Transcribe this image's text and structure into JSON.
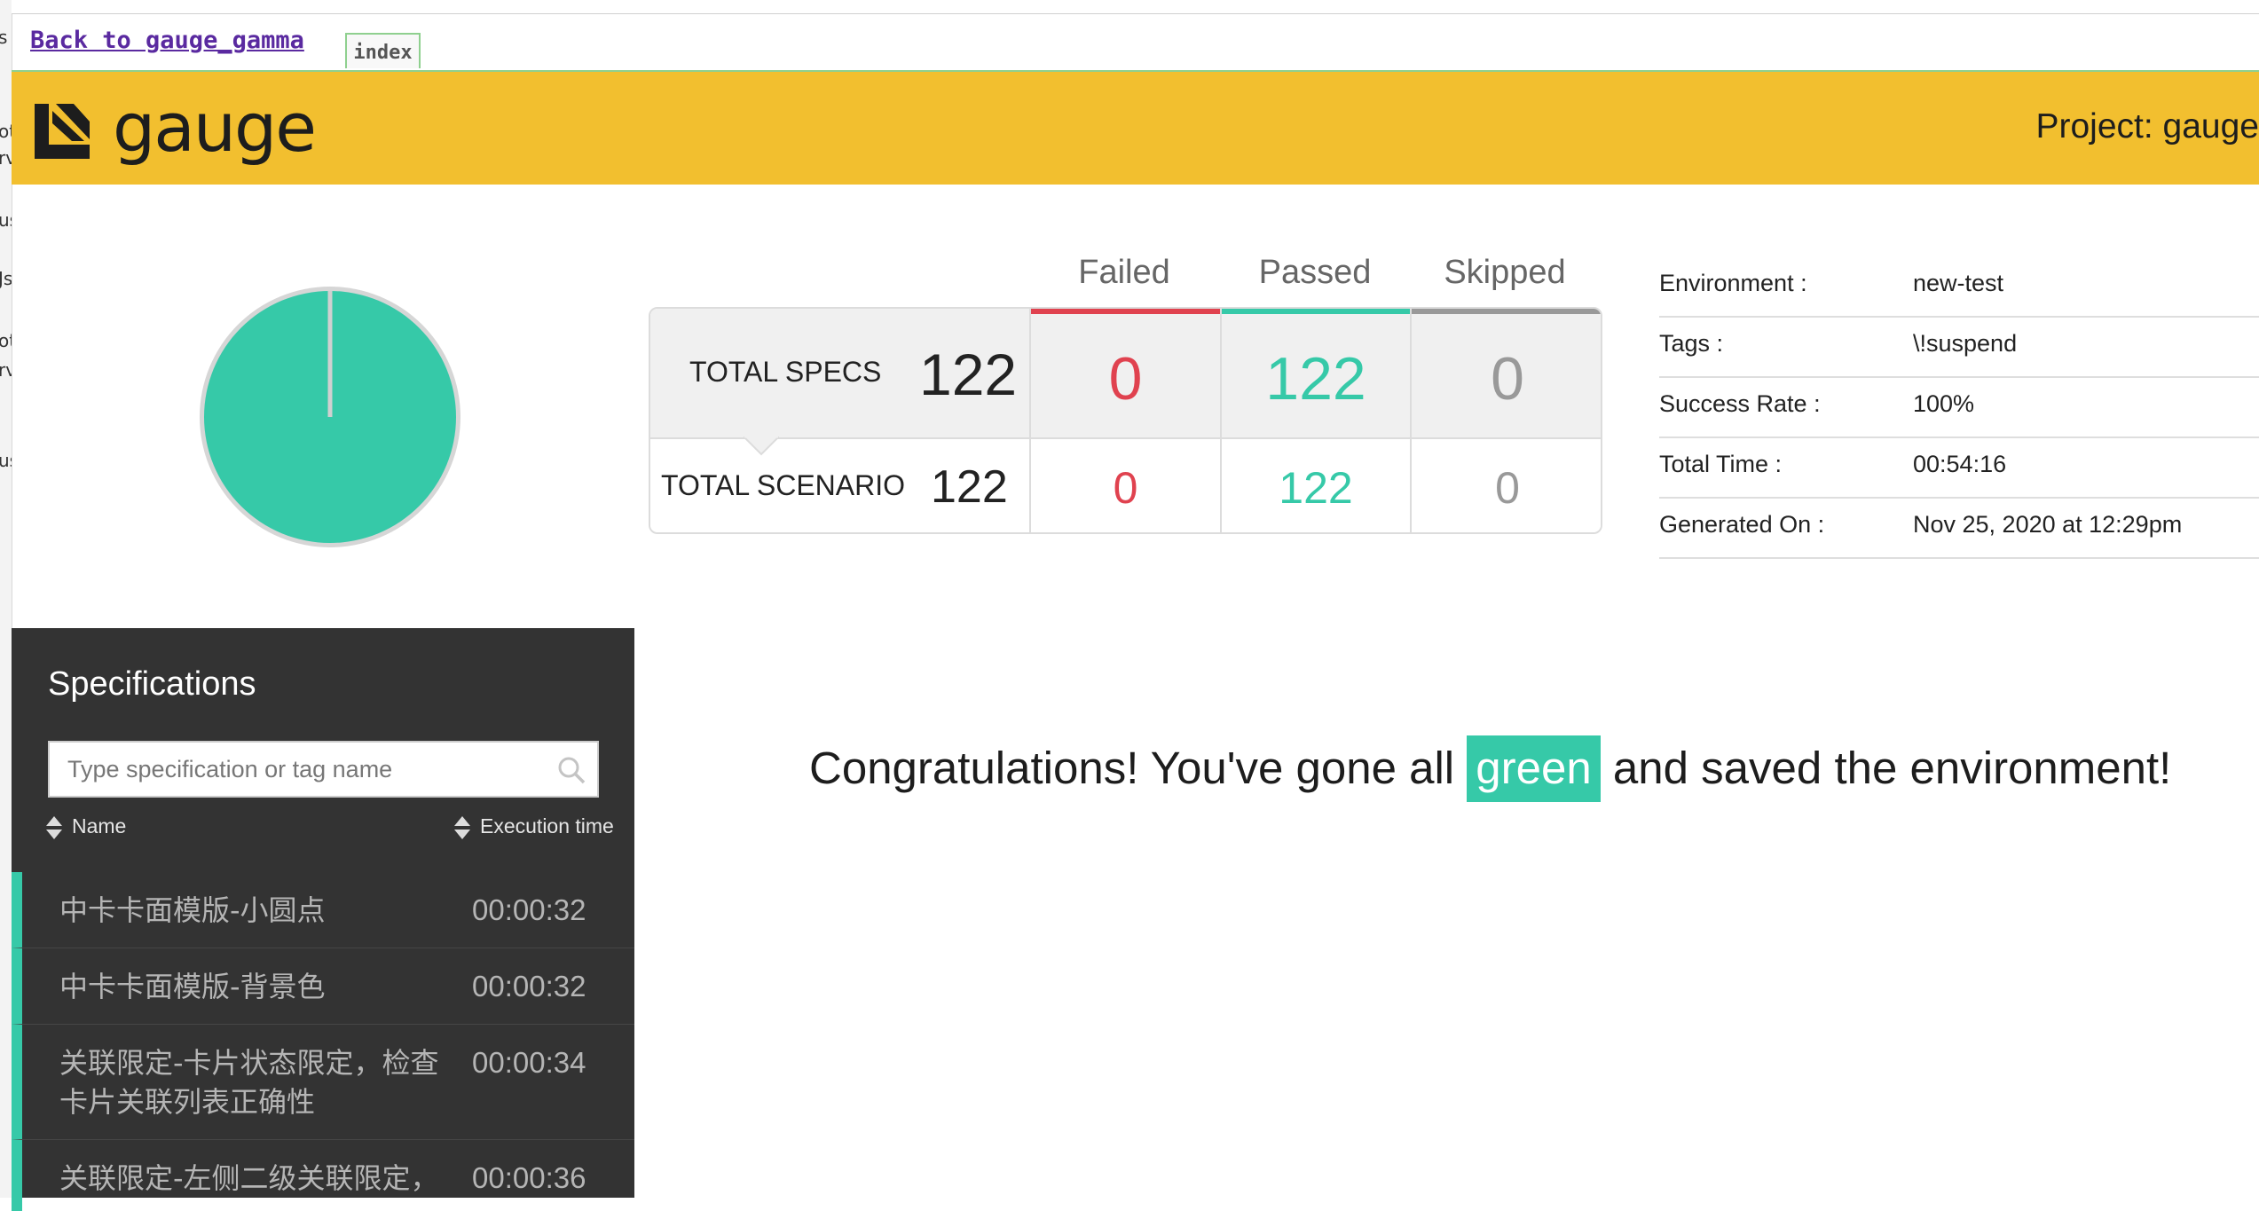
{
  "left_strip_fragments": [
    "s",
    "ot",
    "rv",
    "us",
    "Js",
    "ot",
    "rv",
    "us"
  ],
  "nav": {
    "back_link": "Back to gauge_gamma",
    "index_tab": "index"
  },
  "header": {
    "logo_text": "gauge",
    "project_label": "Project: gauge"
  },
  "colors": {
    "brand_yellow": "#f2bf2f",
    "passed": "#36c9a8",
    "failed": "#e0424f",
    "skipped": "#999999",
    "sidebar_bg": "#333333"
  },
  "pie": {
    "passed_fraction": 1.0,
    "failed_fraction": 0.0,
    "skipped_fraction": 0.0
  },
  "stats": {
    "headers": {
      "failed": "Failed",
      "passed": "Passed",
      "skipped": "Skipped"
    },
    "total_specs": {
      "label": "TOTAL SPECS",
      "total": "122",
      "failed": "0",
      "passed": "122",
      "skipped": "0"
    },
    "total_scenario": {
      "label": "TOTAL SCENARIO",
      "total": "122",
      "failed": "0",
      "passed": "122",
      "skipped": "0"
    }
  },
  "environment": [
    {
      "key": "Environment :",
      "value": "new-test"
    },
    {
      "key": "Tags :",
      "value": "\\!suspend"
    },
    {
      "key": "Success Rate :",
      "value": "100%"
    },
    {
      "key": "Total Time :",
      "value": "00:54:16"
    },
    {
      "key": "Generated On :",
      "value": "Nov 25, 2020 at 12:29pm"
    }
  ],
  "sidebar": {
    "title": "Specifications",
    "search_placeholder": "Type specification or tag name",
    "sort_name": "Name",
    "sort_time": "Execution time",
    "specs": [
      {
        "name": "中卡卡面模版-小圆点",
        "time": "00:00:32"
      },
      {
        "name": "中卡卡面模版-背景色",
        "time": "00:00:32"
      },
      {
        "name": "关联限定-卡片状态限定，检查卡片关联列表正确性",
        "time": "00:00:34"
      },
      {
        "name": "关联限定-左侧二级关联限定，",
        "time": "00:00:36"
      }
    ]
  },
  "congrats": {
    "before": "Congratulations! You've gone all ",
    "highlight": "green",
    "after": " and saved the environment!"
  }
}
